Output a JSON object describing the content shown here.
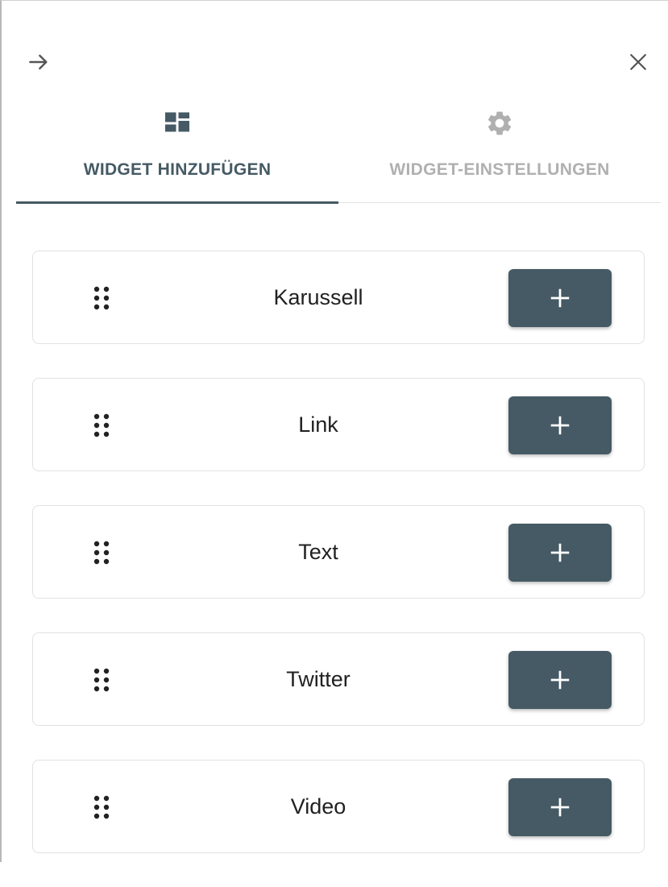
{
  "header": {
    "back_icon": "arrow-right-icon",
    "close_icon": "close-icon"
  },
  "tabs": [
    {
      "label": "WIDGET HINZUFÜGEN",
      "icon": "dashboard-icon",
      "active": true,
      "color": "#455a64"
    },
    {
      "label": "WIDGET-EINSTELLUNGEN",
      "icon": "gear-icon",
      "active": false,
      "color": "#b0b0b0"
    }
  ],
  "widgets": [
    {
      "name": "Karussell",
      "add_label": "+",
      "drag_icon": "drag-handle-icon"
    },
    {
      "name": "Link",
      "add_label": "+",
      "drag_icon": "drag-handle-icon"
    },
    {
      "name": "Text",
      "add_label": "+",
      "drag_icon": "drag-handle-icon"
    },
    {
      "name": "Twitter",
      "add_label": "+",
      "drag_icon": "drag-handle-icon"
    },
    {
      "name": "Video",
      "add_label": "+",
      "drag_icon": "drag-handle-icon"
    }
  ],
  "colors": {
    "primary": "#455a64",
    "inactive": "#b0b0b0",
    "border": "#e2e2e2"
  }
}
